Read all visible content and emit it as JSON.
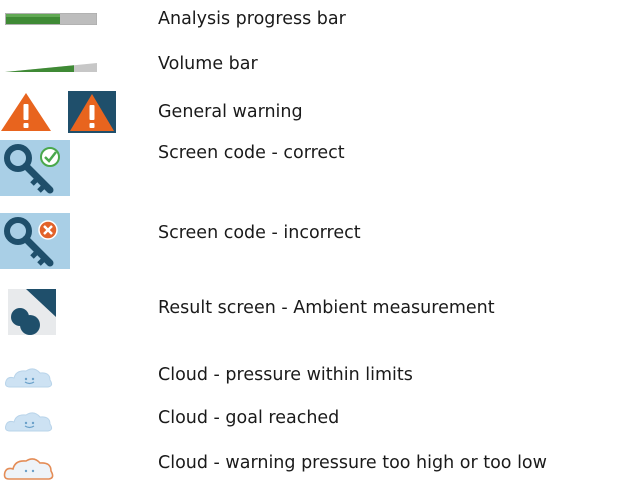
{
  "legend": {
    "items": [
      {
        "icon": "analysis-progress-bar",
        "label": "Analysis progress bar",
        "progress_fraction": 0.6
      },
      {
        "icon": "volume-bar",
        "label": "Volume bar",
        "volume_fraction": 0.75
      },
      {
        "icon": "warning-triangle",
        "label": "General warning"
      },
      {
        "icon": "key-check",
        "label": "Screen code - correct"
      },
      {
        "icon": "key-cross",
        "label": "Screen code - incorrect"
      },
      {
        "icon": "ambient-measurement",
        "label": "Result screen - Ambient measurement"
      },
      {
        "icon": "cloud-smile",
        "label": "Cloud - pressure within limits"
      },
      {
        "icon": "cloud-smile",
        "label": "Cloud - goal reached"
      },
      {
        "icon": "cloud-neutral-warning",
        "label": "Cloud - warning pressure too high or too low"
      }
    ]
  },
  "colors": {
    "progress_fill": "#3f8a35",
    "track": "#bdbdbd",
    "warning_orange": "#e8641e",
    "icon_tile_blue": "#a9cfe6",
    "dark_navy": "#1f4f6b",
    "check_green": "#4aa84c",
    "cross_orange": "#e2622a",
    "cloud_blue": "#cde2f3",
    "cloud_warning_outline": "#e48c56"
  }
}
